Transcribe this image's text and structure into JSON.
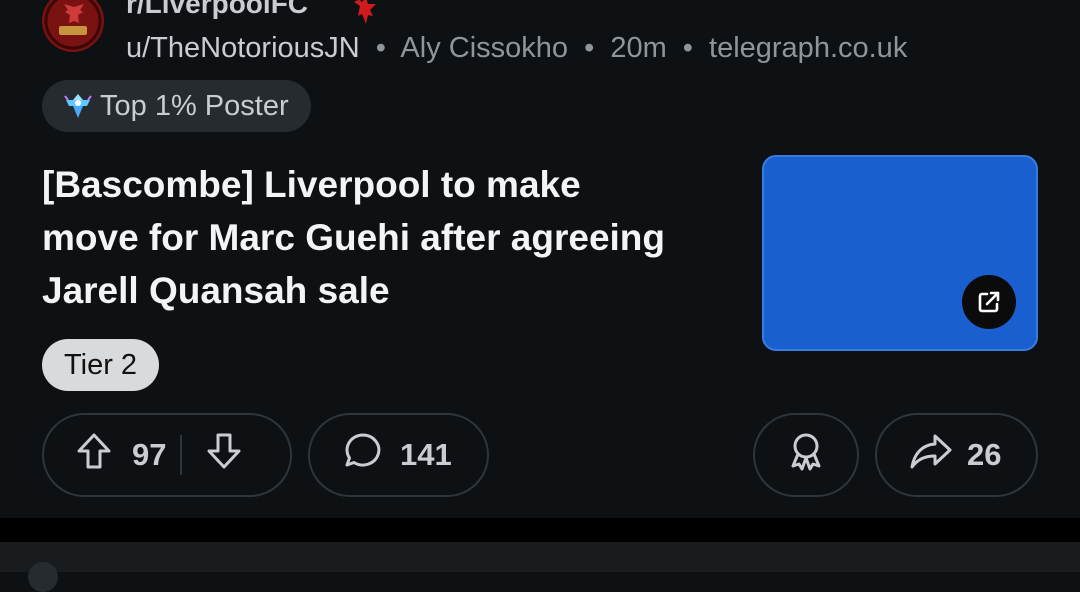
{
  "post": {
    "subreddit": "r/LiverpoolFC",
    "author": "u/TheNotoriousJN",
    "flair_user": "Aly Cissokho",
    "age": "20m",
    "domain": "telegraph.co.uk",
    "separator": "•",
    "poster_badge": "Top 1% Poster",
    "title": "[Bascombe] Liverpool to make move for Marc Guehi after agreeing Jarell Quansah sale",
    "tier_flair": "Tier 2",
    "thumbnail_color": "#1a5fcf"
  },
  "actions": {
    "upvotes": "97",
    "comments": "141",
    "shares": "26"
  },
  "colors": {
    "background": "#0e1113",
    "pill_border": "#2f3539",
    "accent_red": "#d11a1a"
  },
  "icons": {
    "avatar": "subreddit-avatar",
    "crest": "liver-bird-icon",
    "poster": "top-poster-icon",
    "external": "external-link-icon",
    "upvote": "upvote-arrow-icon",
    "downvote": "downvote-arrow-icon",
    "comment": "comment-bubble-icon",
    "award": "award-ribbon-icon",
    "share": "share-arrow-icon"
  }
}
